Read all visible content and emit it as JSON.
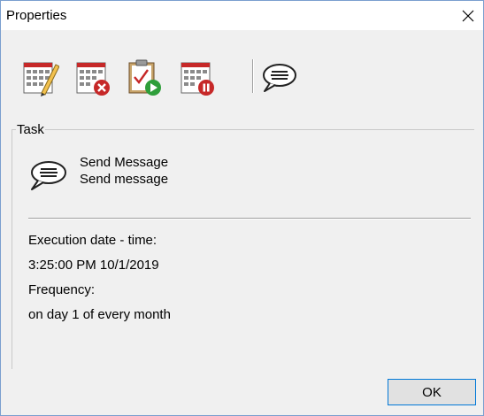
{
  "window": {
    "title": "Properties"
  },
  "toolbar": {
    "buttons": [
      {
        "icon": "calendar-edit-icon"
      },
      {
        "icon": "calendar-delete-icon"
      },
      {
        "icon": "clipboard-run-icon"
      },
      {
        "icon": "calendar-pause-icon"
      },
      {
        "icon": "speech-bubble-icon"
      }
    ]
  },
  "task": {
    "legend": "Task",
    "icon": "speech-bubble-icon",
    "name": "Send Message",
    "description": "Send message"
  },
  "schedule": {
    "execution_label": "Execution date - time:",
    "execution_value": "3:25:00 PM 10/1/2019",
    "frequency_label": "Frequency:",
    "frequency_value": "on day 1 of every month"
  },
  "buttons": {
    "ok": "OK"
  },
  "colors": {
    "accent": "#0078d7",
    "calendar_red": "#c62828",
    "go_green": "#2e9e3a",
    "dialog_bg": "#f0f0f0"
  }
}
